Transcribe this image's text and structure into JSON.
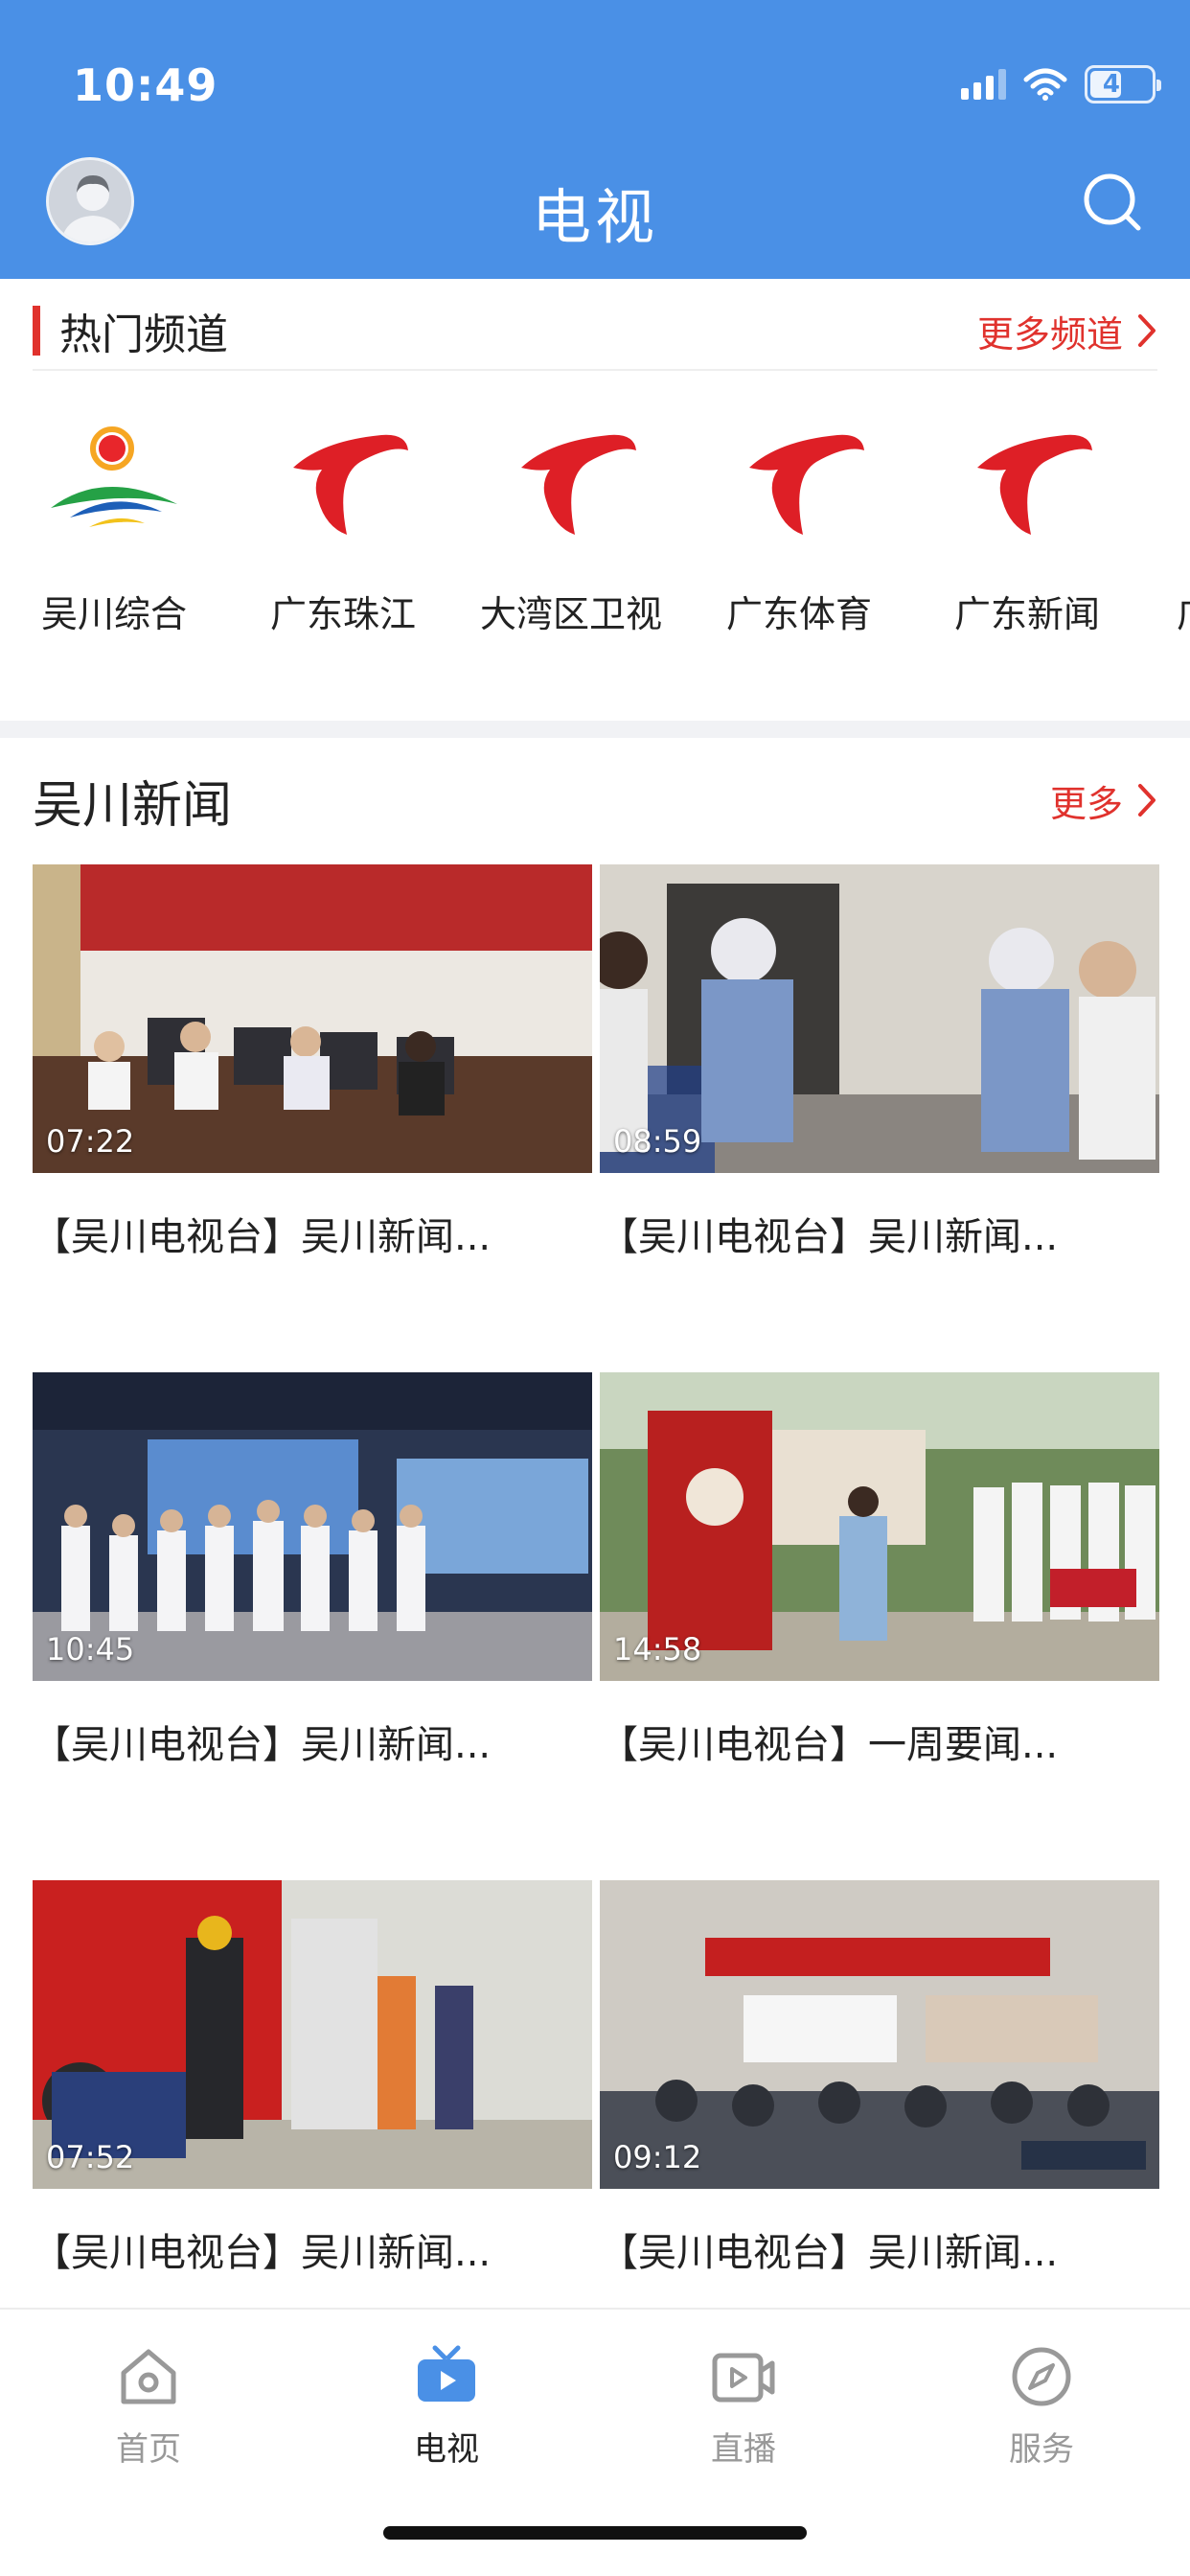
{
  "status_bar": {
    "time": "10:49",
    "battery": "47"
  },
  "header": {
    "title": "电视"
  },
  "hot_channels": {
    "title": "热门频道",
    "more_label": "更多频道",
    "items": [
      {
        "name": "吴川综合",
        "logo": "wuchuan-tv-logo"
      },
      {
        "name": "广东珠江",
        "logo": "guangdong-tv-logo"
      },
      {
        "name": "大湾区卫视",
        "logo": "guangdong-tv-logo"
      },
      {
        "name": "广东体育",
        "logo": "guangdong-tv-logo"
      },
      {
        "name": "广东新闻",
        "logo": "guangdong-tv-logo"
      },
      {
        "name": "广",
        "logo": "guangdong-tv-logo"
      }
    ]
  },
  "news": {
    "title": "吴川新闻",
    "more_label": "更多",
    "items": [
      {
        "duration": "07:22",
        "title": "【吴川电视台】吴川新闻..."
      },
      {
        "duration": "08:59",
        "title": "【吴川电视台】吴川新闻..."
      },
      {
        "duration": "10:45",
        "title": "【吴川电视台】吴川新闻..."
      },
      {
        "duration": "14:58",
        "title": "【吴川电视台】一周要闻..."
      },
      {
        "duration": "07:52",
        "title": "【吴川电视台】吴川新闻..."
      },
      {
        "duration": "09:12",
        "title": "【吴川电视台】吴川新闻..."
      }
    ]
  },
  "tabbar": {
    "items": [
      {
        "label": "首页",
        "icon": "home-icon",
        "active": false
      },
      {
        "label": "电视",
        "icon": "tv-icon",
        "active": true
      },
      {
        "label": "直播",
        "icon": "live-video-icon",
        "active": false
      },
      {
        "label": "服务",
        "icon": "compass-icon",
        "active": false
      }
    ]
  },
  "colors": {
    "header_blue": "#4a90e6",
    "accent_red": "#e0322d",
    "tab_active_blue": "#4a90e6"
  }
}
